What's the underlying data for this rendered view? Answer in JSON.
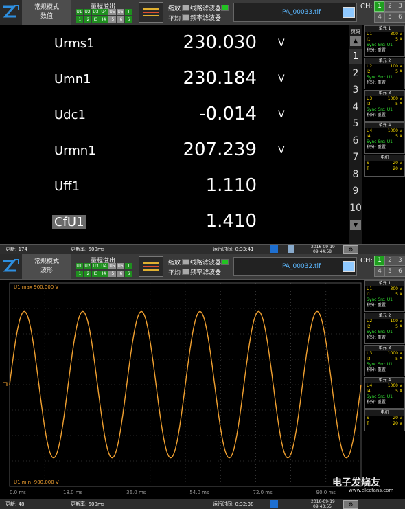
{
  "top": {
    "mode_line1": "常规模式",
    "mode_line2": "数值",
    "overrange_title": "量程溢出",
    "ovf_row1": [
      "U1",
      "U2",
      "U3",
      "U4",
      "U5",
      "U6",
      "T"
    ],
    "ovf_row2": [
      "I1",
      "I2",
      "I3",
      "I4",
      "I5",
      "I6",
      "S"
    ],
    "opt_zoom": "缩放",
    "opt_avg": "平均",
    "opt_line_filter": "线路滤波器",
    "opt_freq_filter": "频率滤波器",
    "filename": "PA_00033.tif",
    "ch_label": "CH:",
    "ch_buttons": [
      "1",
      "2",
      "3",
      "4",
      "5",
      "6"
    ]
  },
  "numeric": {
    "rows": [
      {
        "label": "Urms1",
        "value": "230.030",
        "unit": "V"
      },
      {
        "label": "Umn1",
        "value": "230.184",
        "unit": "V"
      },
      {
        "label": "Udc1",
        "value": "-0.014",
        "unit": "V"
      },
      {
        "label": "Urmn1",
        "value": "207.239",
        "unit": "V"
      },
      {
        "label": "Uff1",
        "value": "1.110",
        "unit": ""
      },
      {
        "label": "CfU1",
        "value": "1.410",
        "unit": ""
      }
    ],
    "page_label": "页码",
    "pages": [
      "1",
      "2",
      "3",
      "4",
      "5",
      "6",
      "7",
      "8",
      "9",
      "10"
    ],
    "up_arrow": "▲",
    "down_arrow": "▼"
  },
  "units": [
    {
      "title": "单元 1",
      "u": "U1",
      "u_range": "300 V",
      "i": "I1",
      "i_range": "5 A",
      "sync": "Sync Src: U1",
      "integ": "积分: 重置"
    },
    {
      "title": "单元 2",
      "u": "U2",
      "u_range": "100 V",
      "i": "I2",
      "i_range": "5 A",
      "sync": "Sync Src: U1",
      "integ": "积分: 重置"
    },
    {
      "title": "单元 3",
      "u": "U3",
      "u_range": "1000 V",
      "i": "I3",
      "i_range": "5 A",
      "sync": "Sync Src: U1",
      "integ": "积分: 重置"
    },
    {
      "title": "单元 4",
      "u": "U4",
      "u_range": "1000 V",
      "i": "I4",
      "i_range": "5 A",
      "sync": "Sync Src: U1",
      "integ": "积分: 重置"
    }
  ],
  "motor": {
    "title": "电机",
    "s_label": "S",
    "s_value": "20 V",
    "t_label": "T",
    "t_value": "20 V"
  },
  "status1": {
    "update": "更新: 174",
    "rate": "更新率: 500ms",
    "runtime": "运行时间: 0:33:41",
    "date": "2016-09-19",
    "time": "09:44:58"
  },
  "top2": {
    "mode_line1": "常规模式",
    "mode_line2": "波形",
    "filename": "PA_00032.tif"
  },
  "units2": [
    {
      "title": "单元 1",
      "u": "U1",
      "u_range": "300 V",
      "i": "I1",
      "i_range": "5 A",
      "sync": "Sync Src: U1",
      "integ": "积分: 重置"
    },
    {
      "title": "单元 2",
      "u": "U2",
      "u_range": "100 V",
      "i": "I2",
      "i_range": "5 A",
      "sync": "Sync Src: U1",
      "integ": "积分: 重置"
    },
    {
      "title": "单元 3",
      "u": "U3",
      "u_range": "1000 V",
      "i": "I3",
      "i_range": "5 A",
      "sync": "Sync Src: U1",
      "integ": "积分: 重置"
    },
    {
      "title": "单元 4",
      "u": "U4",
      "u_range": "1000 V",
      "i": "I4",
      "i_range": "5 A",
      "sync": "Sync Src: U1",
      "integ": "积分: 重置"
    }
  ],
  "motor2": {
    "title": "电机",
    "s_label": "S",
    "s_value": "20 V",
    "t_label": "T",
    "t_value": "20 V"
  },
  "wave": {
    "max_label": "U1   max 900.000 V",
    "min_label": "U1   min -900.000 V",
    "x_ticks": [
      "0.0 ms",
      "18.0 ms",
      "36.0 ms",
      "54.0 ms",
      "72.0 ms",
      "90.0 ms"
    ],
    "cycles": 6,
    "amplitude_fraction": 0.36,
    "color": "#f0a030"
  },
  "status2": {
    "update": "更新: 48",
    "rate": "更新率: 500ms",
    "runtime": "运行时间: 0:32:38",
    "date": "2016-09-19",
    "time": "09:43:55"
  },
  "watermark": "电子发烧友",
  "watermark_url": "www.elecfans.com",
  "colors": {
    "green": "#1f8f1f",
    "yellow": "#ffe000",
    "orange": "#f0a030",
    "link_blue": "#5cb8ff"
  }
}
